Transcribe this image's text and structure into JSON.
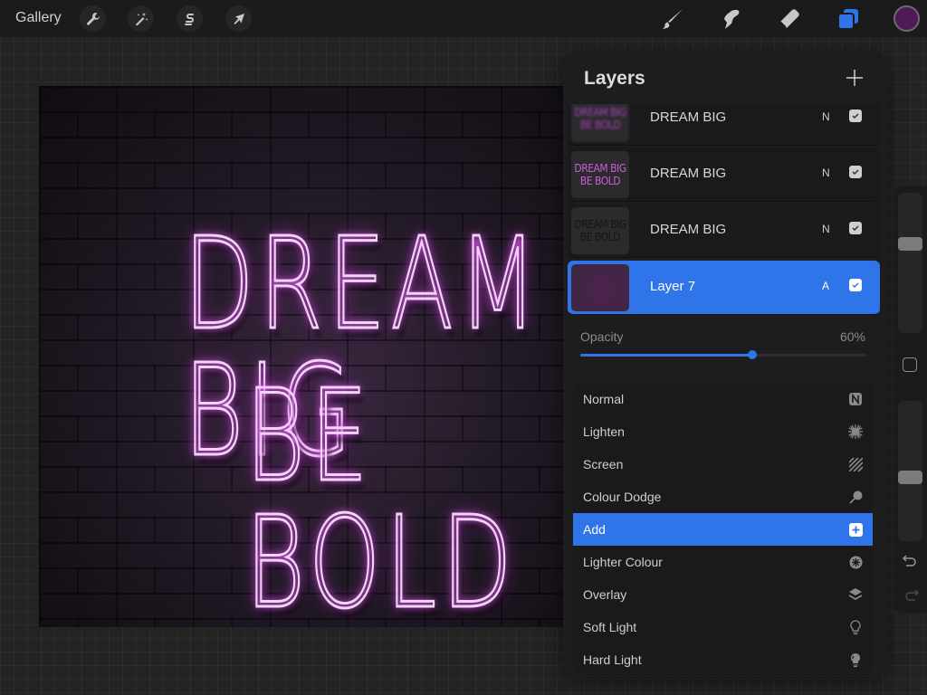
{
  "toolbar": {
    "gallery_label": "Gallery",
    "left_tools": [
      {
        "name": "actions",
        "icon": "wrench-icon"
      },
      {
        "name": "adjustments",
        "icon": "magic-wand-icon"
      },
      {
        "name": "selection",
        "icon": "selection-s-icon"
      },
      {
        "name": "transform",
        "icon": "arrow-cursor-icon"
      }
    ],
    "right_tools": [
      {
        "name": "paint",
        "icon": "brush-icon"
      },
      {
        "name": "smudge",
        "icon": "smudge-finger-icon"
      },
      {
        "name": "erase",
        "icon": "eraser-icon"
      },
      {
        "name": "layers",
        "icon": "layers-icon",
        "active": true
      }
    ],
    "current_color": "#4f1a57"
  },
  "canvas": {
    "line1": "DREAM BIG",
    "line2": "BE BOLD",
    "neon_color": "#d658e6"
  },
  "layers_panel": {
    "title": "Layers",
    "add_icon": "plus-icon",
    "layers": [
      {
        "name": "DREAM BIG",
        "blend": "N",
        "visible": true,
        "thumb_text": [
          "DREAM BIG",
          "BE BOLD"
        ],
        "thumb_style": "blurred-purple"
      },
      {
        "name": "DREAM BIG",
        "blend": "N",
        "visible": true,
        "thumb_text": [
          "DREAM BIG",
          "BE BOLD"
        ],
        "thumb_style": "purple"
      },
      {
        "name": "DREAM BIG",
        "blend": "N",
        "visible": true,
        "thumb_text": [
          "DREAM BIG",
          "BE BOLD"
        ],
        "thumb_style": "dark"
      },
      {
        "name": "Layer 7",
        "blend": "A",
        "visible": true,
        "thumb_text": [],
        "thumb_style": "purple-fill",
        "selected": true
      }
    ],
    "opacity_label": "Opacity",
    "opacity_value": "60%",
    "opacity_fraction": 0.6,
    "blend_modes": [
      {
        "label": "Normal",
        "icon": "n-badge-icon"
      },
      {
        "label": "Lighten",
        "icon": "sunburst-icon"
      },
      {
        "label": "Screen",
        "icon": "hatched-square-icon"
      },
      {
        "label": "Colour Dodge",
        "icon": "dodge-tool-icon"
      },
      {
        "label": "Add",
        "icon": "plus-square-icon",
        "selected": true
      },
      {
        "label": "Lighter Colour",
        "icon": "star-circle-icon"
      },
      {
        "label": "Overlay",
        "icon": "stack-layers-icon"
      },
      {
        "label": "Soft Light",
        "icon": "lightbulb-outline-icon"
      },
      {
        "label": "Hard Light",
        "icon": "lightbulb-filled-icon"
      }
    ]
  },
  "sidebar": {
    "brush_size_fraction": 0.35,
    "brush_opacity_fraction": 0.55,
    "modify_icon": "square-icon",
    "undo_icon": "undo-icon",
    "redo_icon": "redo-icon"
  },
  "colors": {
    "accent": "#2f74e8",
    "panel_bg": "#1d1c1e",
    "toolbar_bg": "#1b1b1b"
  }
}
